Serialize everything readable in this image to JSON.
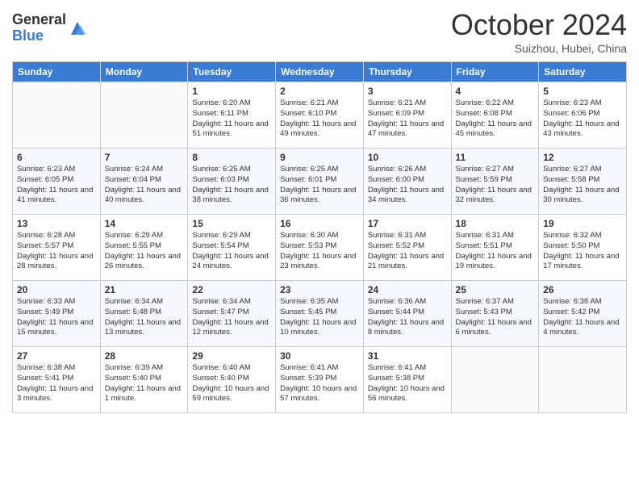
{
  "logo": {
    "general": "General",
    "blue": "Blue"
  },
  "title": "October 2024",
  "subtitle": "Suizhou, Hubei, China",
  "headers": [
    "Sunday",
    "Monday",
    "Tuesday",
    "Wednesday",
    "Thursday",
    "Friday",
    "Saturday"
  ],
  "weeks": [
    [
      {
        "day": "",
        "sunrise": "",
        "sunset": "",
        "daylight": ""
      },
      {
        "day": "",
        "sunrise": "",
        "sunset": "",
        "daylight": ""
      },
      {
        "day": "1",
        "sunrise": "Sunrise: 6:20 AM",
        "sunset": "Sunset: 6:11 PM",
        "daylight": "Daylight: 11 hours and 51 minutes."
      },
      {
        "day": "2",
        "sunrise": "Sunrise: 6:21 AM",
        "sunset": "Sunset: 6:10 PM",
        "daylight": "Daylight: 11 hours and 49 minutes."
      },
      {
        "day": "3",
        "sunrise": "Sunrise: 6:21 AM",
        "sunset": "Sunset: 6:09 PM",
        "daylight": "Daylight: 11 hours and 47 minutes."
      },
      {
        "day": "4",
        "sunrise": "Sunrise: 6:22 AM",
        "sunset": "Sunset: 6:08 PM",
        "daylight": "Daylight: 11 hours and 45 minutes."
      },
      {
        "day": "5",
        "sunrise": "Sunrise: 6:23 AM",
        "sunset": "Sunset: 6:06 PM",
        "daylight": "Daylight: 11 hours and 43 minutes."
      }
    ],
    [
      {
        "day": "6",
        "sunrise": "Sunrise: 6:23 AM",
        "sunset": "Sunset: 6:05 PM",
        "daylight": "Daylight: 11 hours and 41 minutes."
      },
      {
        "day": "7",
        "sunrise": "Sunrise: 6:24 AM",
        "sunset": "Sunset: 6:04 PM",
        "daylight": "Daylight: 11 hours and 40 minutes."
      },
      {
        "day": "8",
        "sunrise": "Sunrise: 6:25 AM",
        "sunset": "Sunset: 6:03 PM",
        "daylight": "Daylight: 11 hours and 38 minutes."
      },
      {
        "day": "9",
        "sunrise": "Sunrise: 6:25 AM",
        "sunset": "Sunset: 6:01 PM",
        "daylight": "Daylight: 11 hours and 36 minutes."
      },
      {
        "day": "10",
        "sunrise": "Sunrise: 6:26 AM",
        "sunset": "Sunset: 6:00 PM",
        "daylight": "Daylight: 11 hours and 34 minutes."
      },
      {
        "day": "11",
        "sunrise": "Sunrise: 6:27 AM",
        "sunset": "Sunset: 5:59 PM",
        "daylight": "Daylight: 11 hours and 32 minutes."
      },
      {
        "day": "12",
        "sunrise": "Sunrise: 6:27 AM",
        "sunset": "Sunset: 5:58 PM",
        "daylight": "Daylight: 11 hours and 30 minutes."
      }
    ],
    [
      {
        "day": "13",
        "sunrise": "Sunrise: 6:28 AM",
        "sunset": "Sunset: 5:57 PM",
        "daylight": "Daylight: 11 hours and 28 minutes."
      },
      {
        "day": "14",
        "sunrise": "Sunrise: 6:29 AM",
        "sunset": "Sunset: 5:55 PM",
        "daylight": "Daylight: 11 hours and 26 minutes."
      },
      {
        "day": "15",
        "sunrise": "Sunrise: 6:29 AM",
        "sunset": "Sunset: 5:54 PM",
        "daylight": "Daylight: 11 hours and 24 minutes."
      },
      {
        "day": "16",
        "sunrise": "Sunrise: 6:30 AM",
        "sunset": "Sunset: 5:53 PM",
        "daylight": "Daylight: 11 hours and 23 minutes."
      },
      {
        "day": "17",
        "sunrise": "Sunrise: 6:31 AM",
        "sunset": "Sunset: 5:52 PM",
        "daylight": "Daylight: 11 hours and 21 minutes."
      },
      {
        "day": "18",
        "sunrise": "Sunrise: 6:31 AM",
        "sunset": "Sunset: 5:51 PM",
        "daylight": "Daylight: 11 hours and 19 minutes."
      },
      {
        "day": "19",
        "sunrise": "Sunrise: 6:32 AM",
        "sunset": "Sunset: 5:50 PM",
        "daylight": "Daylight: 11 hours and 17 minutes."
      }
    ],
    [
      {
        "day": "20",
        "sunrise": "Sunrise: 6:33 AM",
        "sunset": "Sunset: 5:49 PM",
        "daylight": "Daylight: 11 hours and 15 minutes."
      },
      {
        "day": "21",
        "sunrise": "Sunrise: 6:34 AM",
        "sunset": "Sunset: 5:48 PM",
        "daylight": "Daylight: 11 hours and 13 minutes."
      },
      {
        "day": "22",
        "sunrise": "Sunrise: 6:34 AM",
        "sunset": "Sunset: 5:47 PM",
        "daylight": "Daylight: 11 hours and 12 minutes."
      },
      {
        "day": "23",
        "sunrise": "Sunrise: 6:35 AM",
        "sunset": "Sunset: 5:45 PM",
        "daylight": "Daylight: 11 hours and 10 minutes."
      },
      {
        "day": "24",
        "sunrise": "Sunrise: 6:36 AM",
        "sunset": "Sunset: 5:44 PM",
        "daylight": "Daylight: 11 hours and 8 minutes."
      },
      {
        "day": "25",
        "sunrise": "Sunrise: 6:37 AM",
        "sunset": "Sunset: 5:43 PM",
        "daylight": "Daylight: 11 hours and 6 minutes."
      },
      {
        "day": "26",
        "sunrise": "Sunrise: 6:38 AM",
        "sunset": "Sunset: 5:42 PM",
        "daylight": "Daylight: 11 hours and 4 minutes."
      }
    ],
    [
      {
        "day": "27",
        "sunrise": "Sunrise: 6:38 AM",
        "sunset": "Sunset: 5:41 PM",
        "daylight": "Daylight: 11 hours and 3 minutes."
      },
      {
        "day": "28",
        "sunrise": "Sunrise: 6:39 AM",
        "sunset": "Sunset: 5:40 PM",
        "daylight": "Daylight: 11 hours and 1 minute."
      },
      {
        "day": "29",
        "sunrise": "Sunrise: 6:40 AM",
        "sunset": "Sunset: 5:40 PM",
        "daylight": "Daylight: 10 hours and 59 minutes."
      },
      {
        "day": "30",
        "sunrise": "Sunrise: 6:41 AM",
        "sunset": "Sunset: 5:39 PM",
        "daylight": "Daylight: 10 hours and 57 minutes."
      },
      {
        "day": "31",
        "sunrise": "Sunrise: 6:41 AM",
        "sunset": "Sunset: 5:38 PM",
        "daylight": "Daylight: 10 hours and 56 minutes."
      },
      {
        "day": "",
        "sunrise": "",
        "sunset": "",
        "daylight": ""
      },
      {
        "day": "",
        "sunrise": "",
        "sunset": "",
        "daylight": ""
      }
    ]
  ]
}
